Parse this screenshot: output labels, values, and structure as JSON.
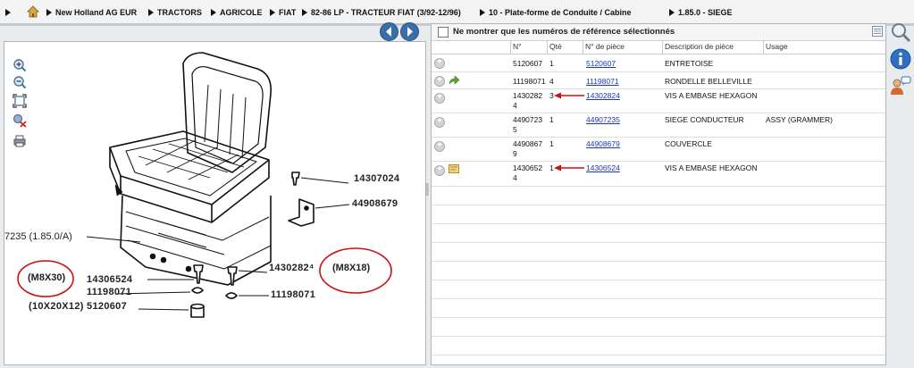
{
  "breadcrumb": [
    "New Holland AG EUR",
    "TRACTORS",
    "AGRICOLE",
    "FIAT",
    "82-86 LP - TRACTEUR FIAT (3/92-12/96)",
    "10 - Plate-forme de Conduite / Cabine",
    "1.85.0 - SIEGE"
  ],
  "filter_label": "Ne montrer que les numéros de référence sélectionnés",
  "columns": [
    "N°",
    "Qté",
    "N° de pièce",
    "Description de pièce",
    "Usage"
  ],
  "rows": [
    {
      "no_line1": "5120607",
      "no_line2": "",
      "qty": "1",
      "part": "5120607",
      "desc": "ENTRETOISE",
      "usage": ""
    },
    {
      "no_line1": "11198071",
      "no_line2": "",
      "qty": "4",
      "part": "11198071",
      "desc": "RONDELLE BELLEVILLE",
      "usage": ""
    },
    {
      "no_line1": "1430282",
      "no_line2": "4",
      "qty": "3",
      "part": "14302824",
      "desc": "VIS A EMBASE HEXAGON",
      "usage": ""
    },
    {
      "no_line1": "4490723",
      "no_line2": "5",
      "qty": "1",
      "part": "44907235",
      "desc": "SIEGE CONDUCTEUR",
      "usage": "ASSY (GRAMMER)"
    },
    {
      "no_line1": "4490867",
      "no_line2": "9",
      "qty": "1",
      "part": "44908679",
      "desc": "COUVERCLE",
      "usage": ""
    },
    {
      "no_line1": "1430652",
      "no_line2": "4",
      "qty": "1",
      "part": "14306524",
      "desc": "VIS A EMBASE HEXAGON",
      "usage": ""
    }
  ],
  "diagram_labels": {
    "p1": "14307024",
    "p2": "44908679",
    "ref": "7235  (1.85.0/A)",
    "p3": "14306524",
    "p4": "11198071",
    "p5": "(10X20X12)  5120607",
    "p6": "1430282⁴",
    "p7": "11198071",
    "m1": "(M8X30)",
    "m2": "(M8X18)"
  },
  "colors": {
    "accent": "#3b6ea8",
    "link": "#1a36c8",
    "annotation": "#cc1111"
  },
  "icons": [
    "home-icon",
    "prev-arrow-icon",
    "next-arrow-icon",
    "zoom-in-icon",
    "zoom-out-icon",
    "fit-icon",
    "no-zoom-icon",
    "print-icon",
    "search-icon",
    "info-icon",
    "support-icon"
  ]
}
